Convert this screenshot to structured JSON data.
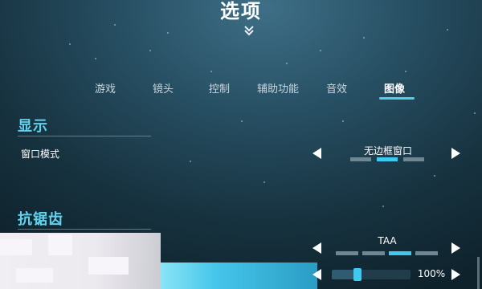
{
  "header": {
    "title": "选项"
  },
  "tabs": [
    {
      "label": "游戏"
    },
    {
      "label": "镜头"
    },
    {
      "label": "控制"
    },
    {
      "label": "辅助功能"
    },
    {
      "label": "音效"
    },
    {
      "label": "图像",
      "active": true
    }
  ],
  "sections": {
    "display": {
      "title": "显示",
      "window_mode": {
        "label": "窗口模式",
        "value": "无边框窗口",
        "options_count": 3,
        "selected_index": 1
      }
    },
    "antialias": {
      "title": "抗锯齿",
      "method": {
        "value": "TAA",
        "options_count": 4,
        "selected_index": 2
      },
      "scale": {
        "value": "100%",
        "level": 0.33
      }
    }
  },
  "colors": {
    "accent": "#3dc9f0",
    "section_title": "#5fd3ee",
    "background": "#17323f"
  },
  "icons": {
    "expand": "double-chevron-down-icon",
    "prev": "arrow-left-icon",
    "next": "arrow-right-icon"
  }
}
